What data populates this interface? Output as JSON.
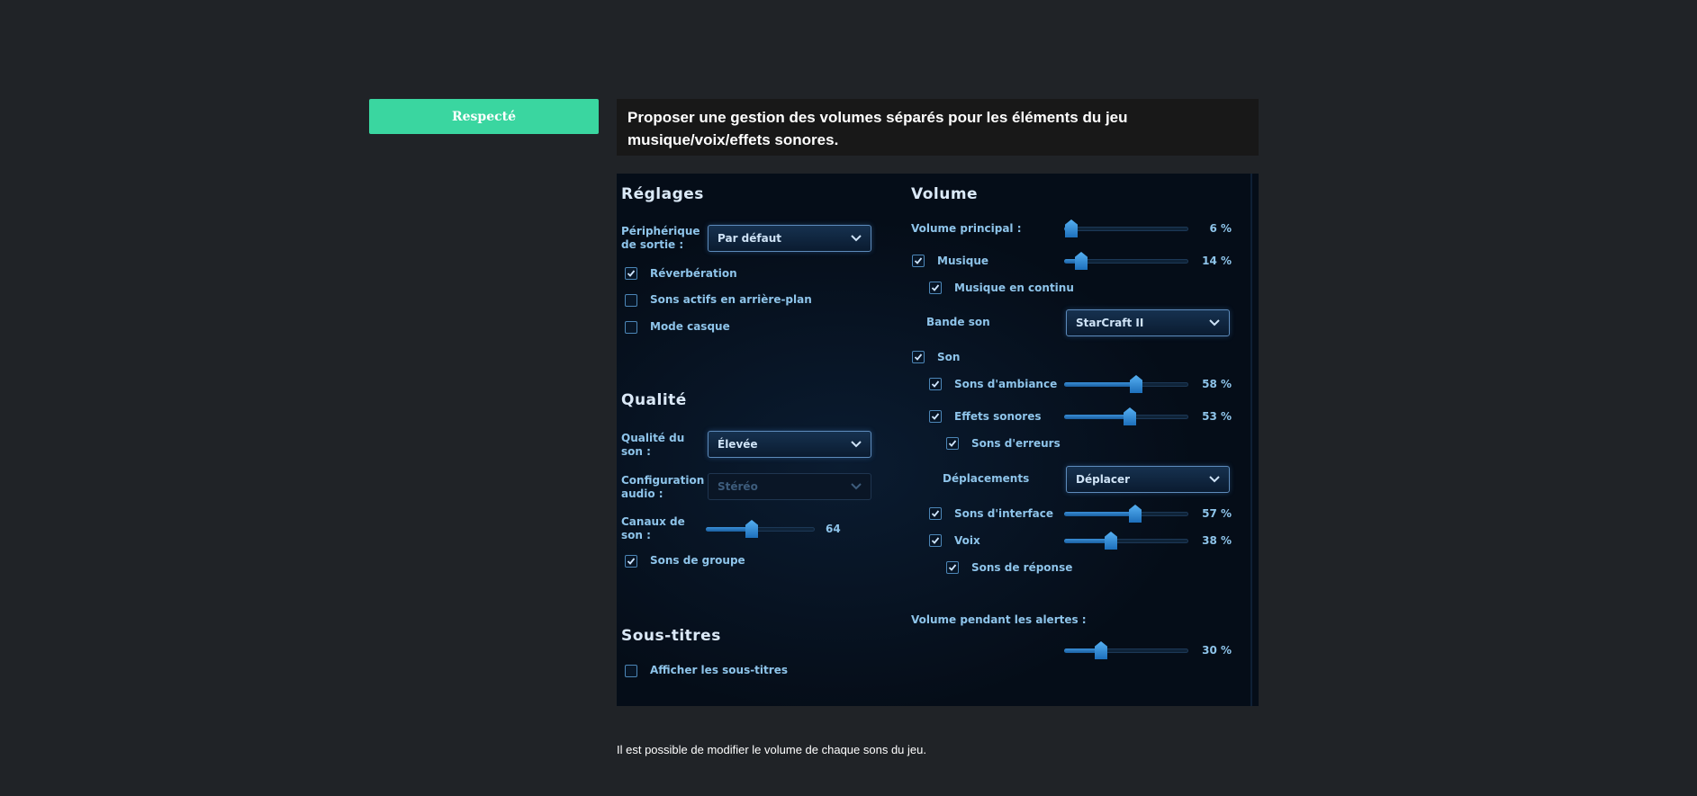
{
  "badge": {
    "label": "Respecté"
  },
  "header": {
    "line1": "Proposer une gestion des volumes séparés pour les éléments du jeu",
    "line2": "musique/voix/effets sonores."
  },
  "settings": {
    "reglages": {
      "title": "Réglages",
      "device_label_1": "Périphérique",
      "device_label_2": "de sortie :",
      "device_value": "Par défaut",
      "reverb": {
        "label": "Réverbération",
        "checked": true
      },
      "background": {
        "label": "Sons actifs en arrière-plan",
        "checked": false
      },
      "headset": {
        "label": "Mode casque",
        "checked": false
      }
    },
    "qualite": {
      "title": "Qualité",
      "quality_label_1": "Qualité du",
      "quality_label_2": "son :",
      "quality_value": "Élevée",
      "config_label_1": "Configuration",
      "config_label_2": "audio :",
      "config_value": "Stéréo",
      "channels_label_1": "Canaux de",
      "channels_label_2": "son :",
      "channels_value": "64",
      "channels_fraction": 0.42,
      "group": {
        "label": "Sons de groupe",
        "checked": true
      }
    },
    "sous_titres": {
      "title": "Sous-titres",
      "show": {
        "label": "Afficher les sous-titres",
        "checked": false
      }
    },
    "volume": {
      "title": "Volume",
      "main": {
        "label": "Volume principal :",
        "value": "6 %",
        "percent": 6
      },
      "music": {
        "label": "Musique",
        "value": "14 %",
        "percent": 14,
        "checked": true
      },
      "music_cont": {
        "label": "Musique en continu",
        "checked": true
      },
      "soundtrack": {
        "label": "Bande son",
        "value": "StarCraft II"
      },
      "sound": {
        "label": "Son",
        "checked": true
      },
      "ambient": {
        "label": "Sons d'ambiance",
        "value": "58 %",
        "percent": 58,
        "checked": true
      },
      "effects": {
        "label": "Effets sonores",
        "value": "53 %",
        "percent": 53,
        "checked": true
      },
      "errors": {
        "label": "Sons d'erreurs",
        "checked": true
      },
      "movement": {
        "label": "Déplacements",
        "value": "Déplacer"
      },
      "interface": {
        "label": "Sons d'interface",
        "value": "57 %",
        "percent": 57,
        "checked": true
      },
      "voice": {
        "label": "Voix",
        "value": "38 %",
        "percent": 38,
        "checked": true
      },
      "responses": {
        "label": "Sons de réponse",
        "checked": true
      },
      "alerts": {
        "label": "Volume pendant les alertes :",
        "value": "30 %",
        "percent": 30
      }
    }
  },
  "caption": "Il est possible de modifier le volume de chaque sons du jeu."
}
